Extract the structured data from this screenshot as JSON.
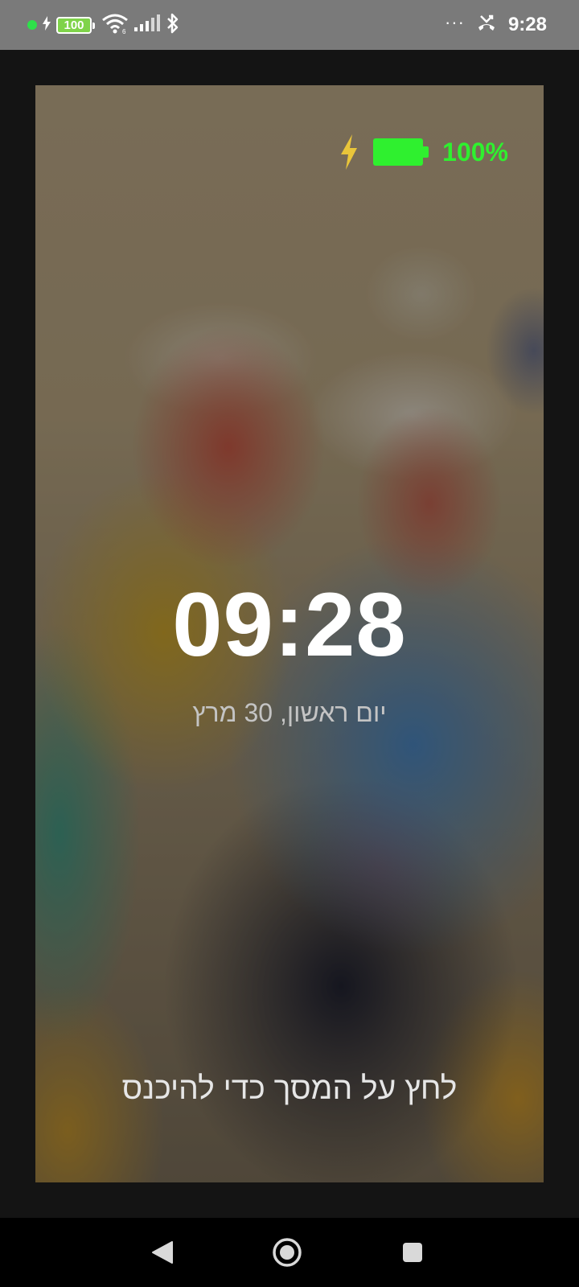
{
  "status_bar": {
    "battery_level": "100",
    "time": "9:28",
    "overflow_dots": "···",
    "icons": [
      "notification-dot-icon",
      "charging-bolt-icon",
      "battery-icon",
      "wifi-icon",
      "signal-icon",
      "bluetooth-icon",
      "missed-call-icon"
    ]
  },
  "lock_screen": {
    "battery_percent": "100%",
    "battery_color": "#2ff02f",
    "bolt_color": "#e9c53a",
    "time": "09:28",
    "date": "יום ראשון, 30 מרץ",
    "unlock_hint": "לחץ על המסך כדי להיכנס"
  },
  "nav_bar": {
    "buttons": [
      "back-icon",
      "home-icon",
      "recents-icon"
    ]
  }
}
